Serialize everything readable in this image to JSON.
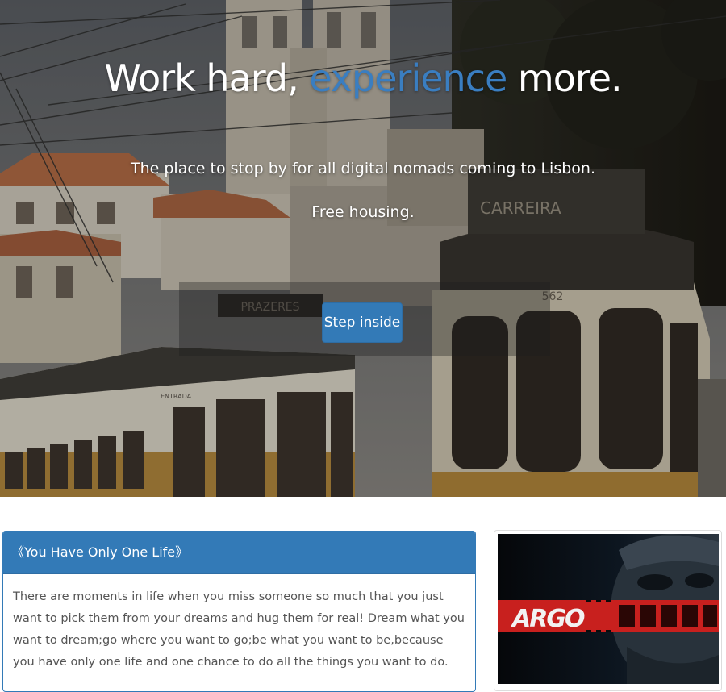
{
  "hero": {
    "title_pre": "Work hard, ",
    "title_accent": "experience",
    "title_post": " more.",
    "subtitle_1": "The place to stop by for all digital nomads coming to Lisbon.",
    "subtitle_2": "Free housing.",
    "cta_label": "Step inside",
    "scene_signs": {
      "tram_left": "PRAZERES",
      "tram_right": "CARREIRA",
      "tram_number": "562",
      "tram_side": "ENTRADA"
    }
  },
  "panel": {
    "heading": "《You Have Only One Life》",
    "body": "There are moments in life when you miss someone so much that you just want to pick them from your dreams and hug them for real! Dream what you want to dream;go where you want to go;be what you want to be,because you have only one life and one chance to do all the things you want to do."
  },
  "thumbnail": {
    "poster_title": "ARGO"
  },
  "colors": {
    "accent": "#337ab7",
    "title_accent": "#3a7ec1",
    "poster_red": "#c8201e"
  }
}
